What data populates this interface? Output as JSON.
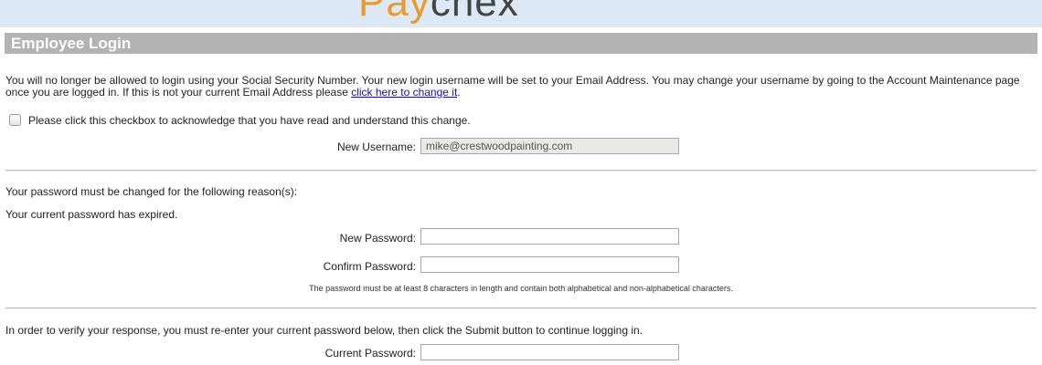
{
  "app": {
    "logo_main": "Pay",
    "logo_rest": "chex"
  },
  "section": {
    "title": "Employee Login"
  },
  "notice": {
    "text": "You will no longer be allowed to login using your Social Security Number. Your new login username will be set to your Email Address. You may change your username by going to the Account Maintenance page once you are logged in. If this is not your current Email Address please ",
    "link_text": "click here to change it",
    "end": "."
  },
  "acknowledge": {
    "label": "Please click this checkbox to acknowledge that you have read and understand this change."
  },
  "username": {
    "label": "New Username:",
    "value": "mike@crestwoodpainting.com"
  },
  "password_change": {
    "reason_heading": "Your password must be changed for the following reason(s):",
    "reason": "Your current password has expired.",
    "new_label": "New Password:",
    "confirm_label": "Confirm Password:",
    "hint": "The password must be at least 8 characters in length and contain both alphabetical and non-alphabetical characters."
  },
  "verify": {
    "text": "In order to verify your response, you must re-enter your current password below, then click the Submit button to continue logging in.",
    "current_label": "Current Password:"
  },
  "colors": {
    "banner": "#dce8f5",
    "section_bar": "#b3b3b3",
    "logo_accent": "#e79a2e",
    "link": "#1a0dab"
  }
}
